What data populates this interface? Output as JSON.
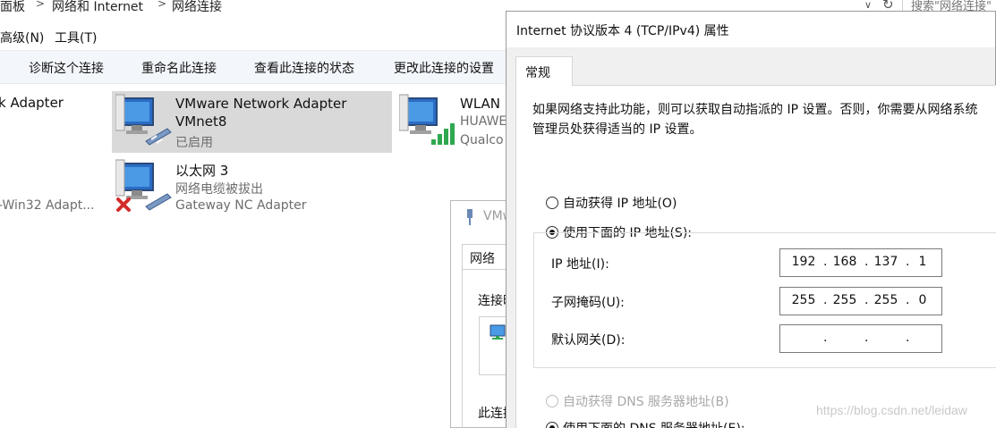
{
  "breadcrumb": {
    "items": [
      "面板",
      "网络和 Internet",
      "网络连接"
    ]
  },
  "search": {
    "placeholder": "搜索\"网络连接\""
  },
  "menu": {
    "items": [
      "高级(N)",
      "工具(T)"
    ]
  },
  "commands": [
    "诊断这个连接",
    "重命名此连接",
    "查看此连接的状态",
    "更改此连接的设置"
  ],
  "adapters": [
    {
      "name": "k Adapter",
      "lines": []
    },
    {
      "name": "VMware Network Adapter",
      "lines": [
        "VMnet8",
        "已启用"
      ]
    },
    {
      "name": "WLAN",
      "lines": [
        "HUAWE",
        "Qualco"
      ]
    },
    {
      "name": "",
      "lines": [
        "-Win32 Adapt..."
      ]
    },
    {
      "name": "以太网 3",
      "lines": [
        "网络电缆被拔出",
        "Gateway NC Adapter"
      ]
    }
  ],
  "mid_dialog": {
    "title": "VMw",
    "tab": "网络",
    "connect_label": "连接时",
    "this_conn_label": "此连接"
  },
  "ipv4": {
    "title": "Internet 协议版本 4 (TCP/IPv4) 属性",
    "tab": "常规",
    "description": "如果网络支持此功能，则可以获取自动指派的 IP 设置。否则，你需要从网络系统管理员处获得适当的 IP 设置。",
    "auto_ip": "自动获得 IP 地址(O)",
    "manual_ip": "使用下面的 IP 地址(S):",
    "ip_label": "IP 地址(I):",
    "ip_address": [
      "192",
      "168",
      "137",
      "1"
    ],
    "mask_label": "子网掩码(U):",
    "subnet_mask": [
      "255",
      "255",
      "255",
      "0"
    ],
    "gateway_label": "默认网关(D):",
    "gateway": [
      "",
      "",
      "",
      ""
    ],
    "auto_dns": "自动获得 DNS 服务器地址(B)",
    "manual_dns": "使用下面的 DNS 服务器地址(E):"
  },
  "watermark": "https://blog.csdn.net/leidaw"
}
